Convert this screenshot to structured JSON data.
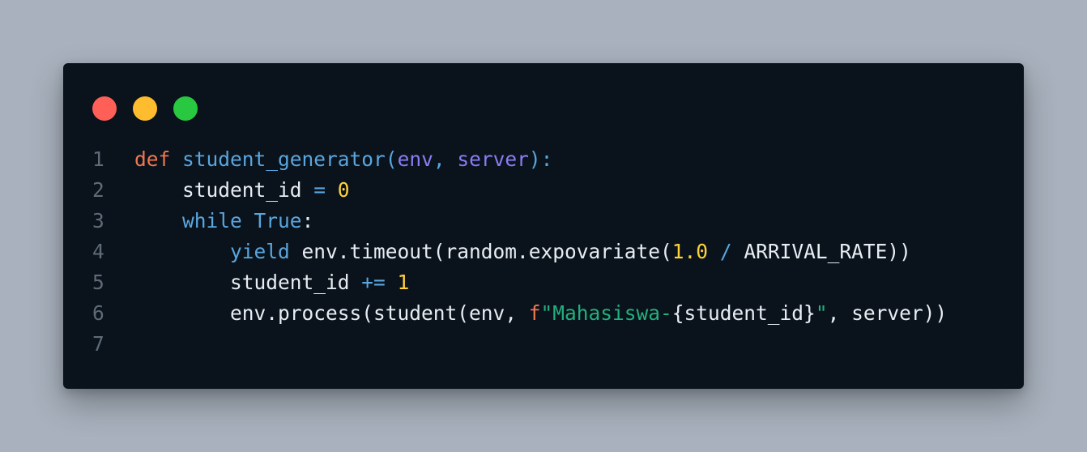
{
  "window": {
    "traffic_lights": [
      {
        "name": "close",
        "color": "#fe5f57"
      },
      {
        "name": "minimize",
        "color": "#febc2e"
      },
      {
        "name": "maximize",
        "color": "#28c840"
      }
    ]
  },
  "code": {
    "line_numbers": [
      "1",
      "2",
      "3",
      "4",
      "5",
      "6",
      "7"
    ],
    "lines": [
      [
        {
          "t": "def",
          "c": "kw-def"
        },
        {
          "t": " ",
          "c": "plain"
        },
        {
          "t": "student_generator",
          "c": "fn"
        },
        {
          "t": "(",
          "c": "punct-blue"
        },
        {
          "t": "env",
          "c": "param"
        },
        {
          "t": ", ",
          "c": "punct-blue"
        },
        {
          "t": "server",
          "c": "param"
        },
        {
          "t": "):",
          "c": "punct-blue"
        }
      ],
      [
        {
          "t": "    student_id ",
          "c": "plain"
        },
        {
          "t": "=",
          "c": "op"
        },
        {
          "t": " ",
          "c": "plain"
        },
        {
          "t": "0",
          "c": "num"
        }
      ],
      [
        {
          "t": "    ",
          "c": "plain"
        },
        {
          "t": "while",
          "c": "kw-ctl"
        },
        {
          "t": " ",
          "c": "plain"
        },
        {
          "t": "True",
          "c": "kw-ctl"
        },
        {
          "t": ":",
          "c": "plain"
        }
      ],
      [
        {
          "t": "        ",
          "c": "plain"
        },
        {
          "t": "yield",
          "c": "kw-ctl"
        },
        {
          "t": " env.timeout(random.expovariate(",
          "c": "plain"
        },
        {
          "t": "1.0",
          "c": "num"
        },
        {
          "t": " ",
          "c": "plain"
        },
        {
          "t": "/",
          "c": "op"
        },
        {
          "t": " ARRIVAL_RATE))",
          "c": "plain"
        }
      ],
      [
        {
          "t": "        student_id ",
          "c": "plain"
        },
        {
          "t": "+=",
          "c": "op"
        },
        {
          "t": " ",
          "c": "plain"
        },
        {
          "t": "1",
          "c": "num"
        }
      ],
      [
        {
          "t": "        env.process(student(env, ",
          "c": "plain"
        },
        {
          "t": "f",
          "c": "prefix"
        },
        {
          "t": "\"Mahasiswa-",
          "c": "str"
        },
        {
          "t": "{student_id}",
          "c": "plain"
        },
        {
          "t": "\"",
          "c": "str"
        },
        {
          "t": ", server))",
          "c": "plain"
        }
      ],
      []
    ]
  }
}
